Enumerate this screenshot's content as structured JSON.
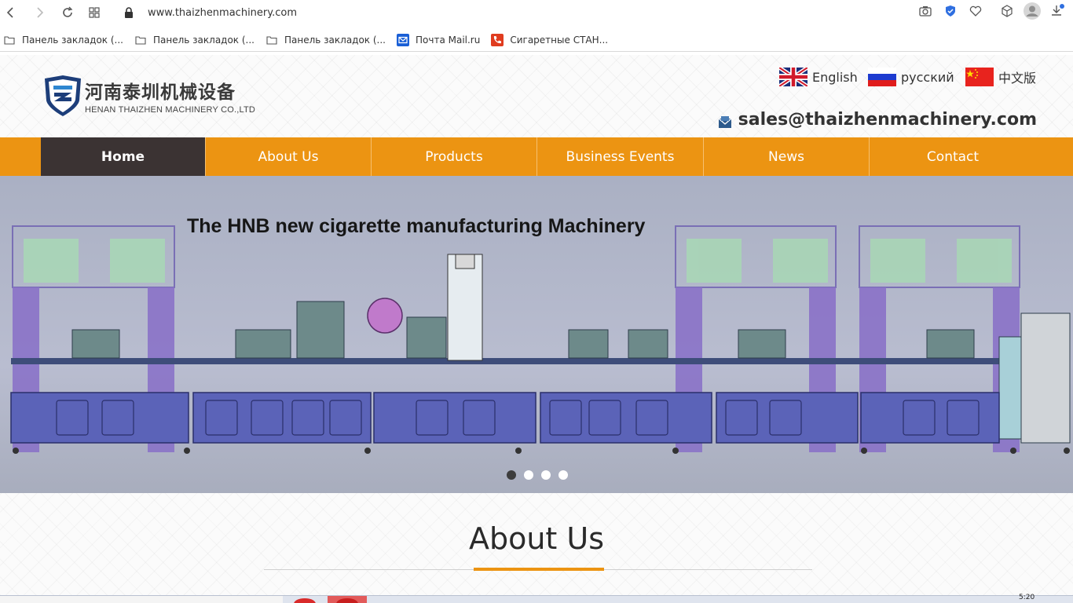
{
  "browser": {
    "url": "www.thaizhenmachinery.com",
    "bookmarks": [
      {
        "label": "Панель закладок (...",
        "icon": "folder-icon"
      },
      {
        "label": "Панель закладок (...",
        "icon": "folder-icon"
      },
      {
        "label": "Панель закладок (...",
        "icon": "folder-icon"
      },
      {
        "label": "Почта Mail.ru",
        "icon": "mail-ru-icon"
      },
      {
        "label": "Сигаретные СТАН...",
        "icon": "phone-icon"
      }
    ]
  },
  "header": {
    "logo_cn": "河南泰圳机械设备",
    "logo_en": "HENAN THAIZHEN MACHINERY CO.,LTD",
    "languages": [
      {
        "label": "English",
        "flag": "uk-flag-icon"
      },
      {
        "label": "русский",
        "flag": "russia-flag-icon"
      },
      {
        "label": "中文版",
        "flag": "china-flag-icon"
      }
    ],
    "email": "sales@thaizhenmachinery.com"
  },
  "nav": {
    "items": [
      "Home",
      "About Us",
      "Products",
      "Business Events",
      "News",
      "Contact"
    ],
    "active": "Home"
  },
  "banner": {
    "title": "The HNB new cigarette manufacturing Machinery",
    "slide_count": 4,
    "active_slide": 1
  },
  "about": {
    "title": "About Us"
  },
  "taskbar": {
    "time": "5:20"
  },
  "colors": {
    "nav_orange": "#ec9412",
    "nav_active": "#3b3333",
    "machine_purple": "#8a72c8",
    "machine_blue": "#5b63b8"
  }
}
